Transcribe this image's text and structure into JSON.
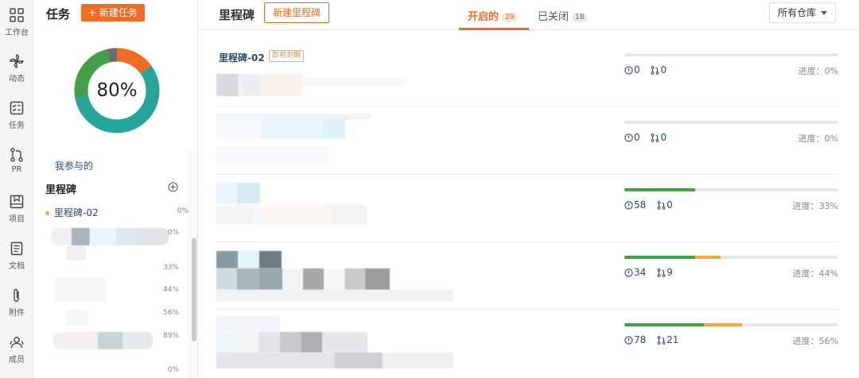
{
  "rail": {
    "items": [
      {
        "label": "工作台",
        "icon": "dashboard-icon"
      },
      {
        "label": "动态",
        "icon": "pinwheel-icon"
      },
      {
        "label": "任务",
        "icon": "task-icon"
      },
      {
        "label": "PR",
        "icon": "pull-request-icon"
      },
      {
        "label": "项目",
        "icon": "project-icon"
      },
      {
        "label": "文档",
        "icon": "document-icon"
      },
      {
        "label": "附件",
        "icon": "paperclip-icon"
      },
      {
        "label": "成员",
        "icon": "members-icon"
      }
    ]
  },
  "panel": {
    "title": "任务",
    "new_task_label": "+ 新建任务",
    "donut_percent": "80%",
    "donut_segments": {
      "orange": 0.15,
      "teal": 0.57,
      "green": 0.24,
      "gray": 0.04
    },
    "participated_label": "我参与的",
    "milestone_heading": "里程碑",
    "milestones": [
      {
        "name": "里程碑-02",
        "pct": "0%"
      },
      {
        "pct": "0%"
      },
      {
        "pct": "33%"
      },
      {
        "pct": "44%"
      },
      {
        "pct": "56%"
      },
      {
        "pct": "89%"
      },
      {
        "pct": "0%"
      }
    ]
  },
  "main": {
    "title": "里程碑",
    "new_milestone_label": "新建里程碑",
    "tabs": [
      {
        "label": "开启的",
        "count": "29"
      },
      {
        "label": "已关闭",
        "count": "18"
      }
    ],
    "repo_filter": "所有仓库",
    "cards": [
      {
        "title": "里程碑-02",
        "badge": "即将到期",
        "issues": "0",
        "prs": "0",
        "progress_label": "进度：",
        "progress": "0%",
        "green": 0,
        "orange": 0
      },
      {
        "title": "",
        "badge": "",
        "issues": "0",
        "prs": "0",
        "progress_label": "进度：",
        "progress": "0%",
        "green": 0,
        "orange": 0
      },
      {
        "title": "",
        "badge": "",
        "issues": "58",
        "prs": "0",
        "progress_label": "进度：",
        "progress": "33%",
        "green": 0.33,
        "orange": 0
      },
      {
        "title": "",
        "badge": "",
        "issues": "34",
        "prs": "9",
        "progress_label": "进度：",
        "progress": "44%",
        "green": 0.33,
        "orange": 0.12
      },
      {
        "title": "",
        "badge": "",
        "issues": "78",
        "prs": "21",
        "progress_label": "进度：",
        "progress": "56%",
        "green": 0.37,
        "orange": 0.18
      }
    ]
  },
  "colors": {
    "accent": "#f36b21",
    "green": "#43a047",
    "teal": "#26a69a",
    "orange": "#f2a93b",
    "link": "#2c4a6b"
  }
}
